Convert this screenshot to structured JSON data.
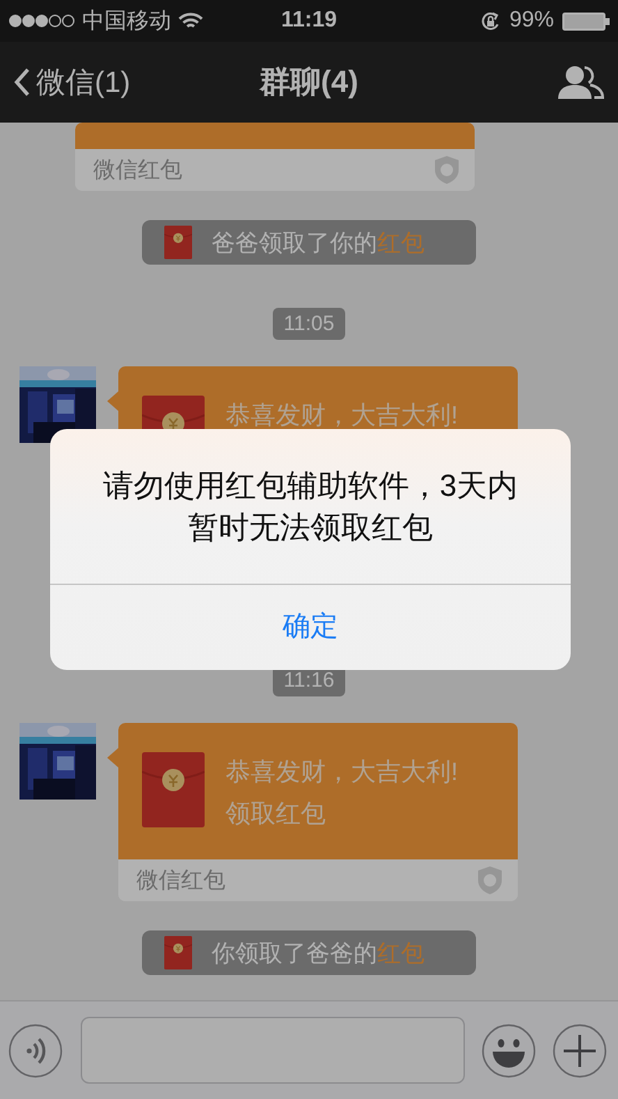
{
  "status_bar": {
    "carrier": "中国移动",
    "time": "11:19",
    "battery": "99%"
  },
  "nav": {
    "back": "微信(1)",
    "title": "群聊(4)"
  },
  "messages": [
    {
      "kind": "packet",
      "outgoing": true,
      "footer": "微信红包"
    },
    {
      "kind": "notice",
      "text": "爸爸领取了你的",
      "link": "红包"
    },
    {
      "kind": "time",
      "text": "11:05"
    },
    {
      "kind": "packet",
      "outgoing": false,
      "greeting": "恭喜发财，大吉大利!"
    },
    {
      "kind": "time",
      "text": "11:16"
    },
    {
      "kind": "packet",
      "outgoing": false,
      "greeting": "恭喜发财，大吉大利!",
      "action": "领取红包",
      "footer": "微信红包"
    },
    {
      "kind": "notice",
      "text": "你领取了爸爸的",
      "link": "红包"
    }
  ],
  "alert": {
    "message": "请勿使用红包辅助软件，3天内暂时无法领取红包",
    "button": "确定"
  }
}
